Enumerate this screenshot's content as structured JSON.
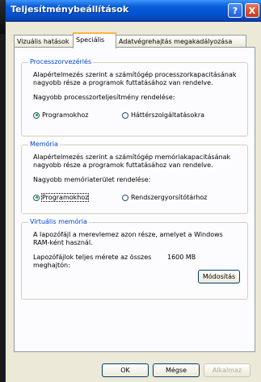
{
  "window": {
    "title": "Teljesítménybeállítások",
    "help": "?",
    "close": "X"
  },
  "tabs": [
    {
      "label": "Vizuális hatások"
    },
    {
      "label": "Speciális"
    },
    {
      "label": "Adatvégrehajtás megakadályozása"
    }
  ],
  "processor": {
    "legend": "Processzorvezérlés",
    "line1": "Alapértelmezés szerint a számítógép processzorkapacitásának",
    "line2": "nagyobb része a programok futtatásához van rendelve.",
    "prompt": "Nagyobb processzorteljesítmény rendelése:",
    "opt_programs": "Programokhoz",
    "opt_services": "Háttérszolgáltatásokra"
  },
  "memory": {
    "legend": "Memória",
    "line1": "Alapértelmezés szerint a számítógép memóriakapacitásának",
    "line2": "nagyobb része a programok futtatásához van rendelve.",
    "prompt": "Nagyobb memóriaterület rendelése:",
    "opt_programs": "Programokhoz",
    "opt_cache": "Rendszergyorsítótárhoz"
  },
  "virtual": {
    "legend": "Virtuális memória",
    "line1": "A lapozófájl a merevlemez azon része, amelyet a Windows",
    "line2": "RAM-ként használ.",
    "size_label1": "Lapozófájlok teljes mérete az összes",
    "size_label2": "meghajtón:",
    "size_value": "1600 MB",
    "change_button": "Módosítás"
  },
  "buttons": {
    "ok": "OK",
    "cancel": "Mégse",
    "apply": "Alkalmaz"
  }
}
